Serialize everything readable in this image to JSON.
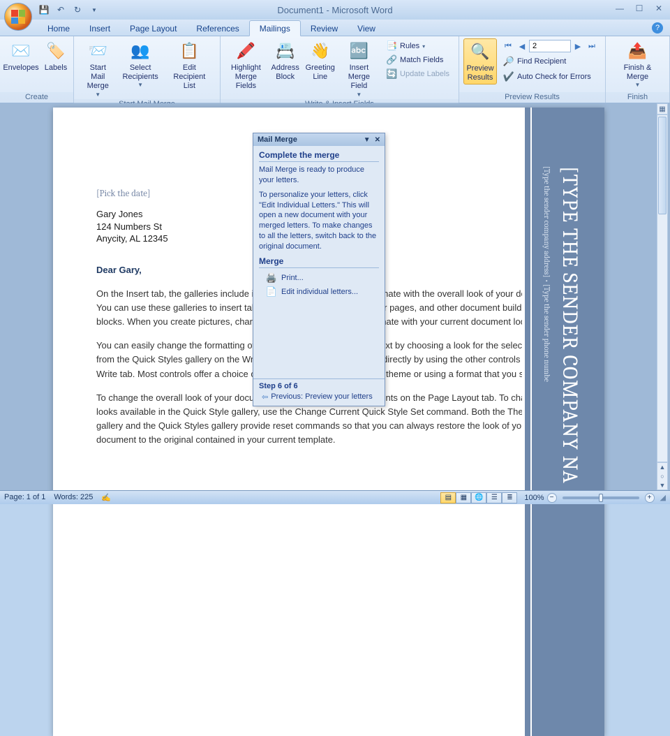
{
  "title": "Document1 - Microsoft Word",
  "tabs": {
    "home": "Home",
    "insert": "Insert",
    "page_layout": "Page Layout",
    "references": "References",
    "mailings": "Mailings",
    "review": "Review",
    "view": "View"
  },
  "ribbon": {
    "create": {
      "label": "Create",
      "envelopes": "Envelopes",
      "labels": "Labels"
    },
    "start_mail_merge": {
      "label": "Start Mail Merge",
      "start": "Start Mail\nMerge",
      "select": "Select\nRecipients",
      "edit": "Edit\nRecipient List"
    },
    "write_insert": {
      "label": "Write & Insert Fields",
      "highlight": "Highlight\nMerge Fields",
      "address": "Address\nBlock",
      "greeting": "Greeting\nLine",
      "insert_field": "Insert Merge\nField",
      "rules": "Rules",
      "match": "Match Fields",
      "update": "Update Labels"
    },
    "preview": {
      "label": "Preview Results",
      "button": "Preview\nResults",
      "record": "2",
      "find": "Find Recipient",
      "auto_check": "Auto Check for Errors"
    },
    "finish": {
      "label": "Finish",
      "button": "Finish &\nMerge"
    }
  },
  "document": {
    "date_placeholder": "[Pick the date]",
    "recipient_name": "Gary Jones",
    "recipient_street": "124 Numbers St",
    "recipient_city": "Anycity, AL 12345",
    "salutation": "Dear Gary,",
    "para1": "On the Insert tab, the galleries include items that are designed to coordinate with the overall look of your document. You can use these galleries to insert tables, headers, footers, lists, cover pages, and other document building blocks. When you create pictures, charts, or diagrams, they also coordinate with your current document look.",
    "para2": "You can easily change the formatting of selected text in the document text by choosing a look for the selected text from the Quick Styles gallery on the Write tab. You can also format text directly by using the other controls on the Write tab. Most controls offer a choice of using the look from the current theme or using a format that you specify.",
    "para3": "To change the overall look of your document, choose new Theme elements on the Page Layout tab. To change the looks available in the Quick Style gallery, use the Change Current Quick Style Set command. Both the Themes gallery and the Quick Styles gallery provide reset commands so that you can always restore the look of your document to the original contained in your current template.",
    "sidebar_title": "[TYPE THE SENDER COMPANY NA",
    "sidebar_sub": "[Type the sender company address] • [Type the sender phone numbe"
  },
  "taskpane": {
    "title": "Mail Merge",
    "heading1": "Complete the merge",
    "text1": "Mail Merge is ready to produce your letters.",
    "text2": "To personalize your letters, click \"Edit Individual Letters.\" This will open a new document with your merged letters. To make changes to all the letters, switch back to the original document.",
    "heading2": "Merge",
    "print": "Print...",
    "edit_letters": "Edit individual letters...",
    "step": "Step 6 of 6",
    "previous": "Previous: Preview your letters"
  },
  "statusbar": {
    "page": "Page: 1 of 1",
    "words": "Words: 225",
    "zoom": "100%"
  }
}
